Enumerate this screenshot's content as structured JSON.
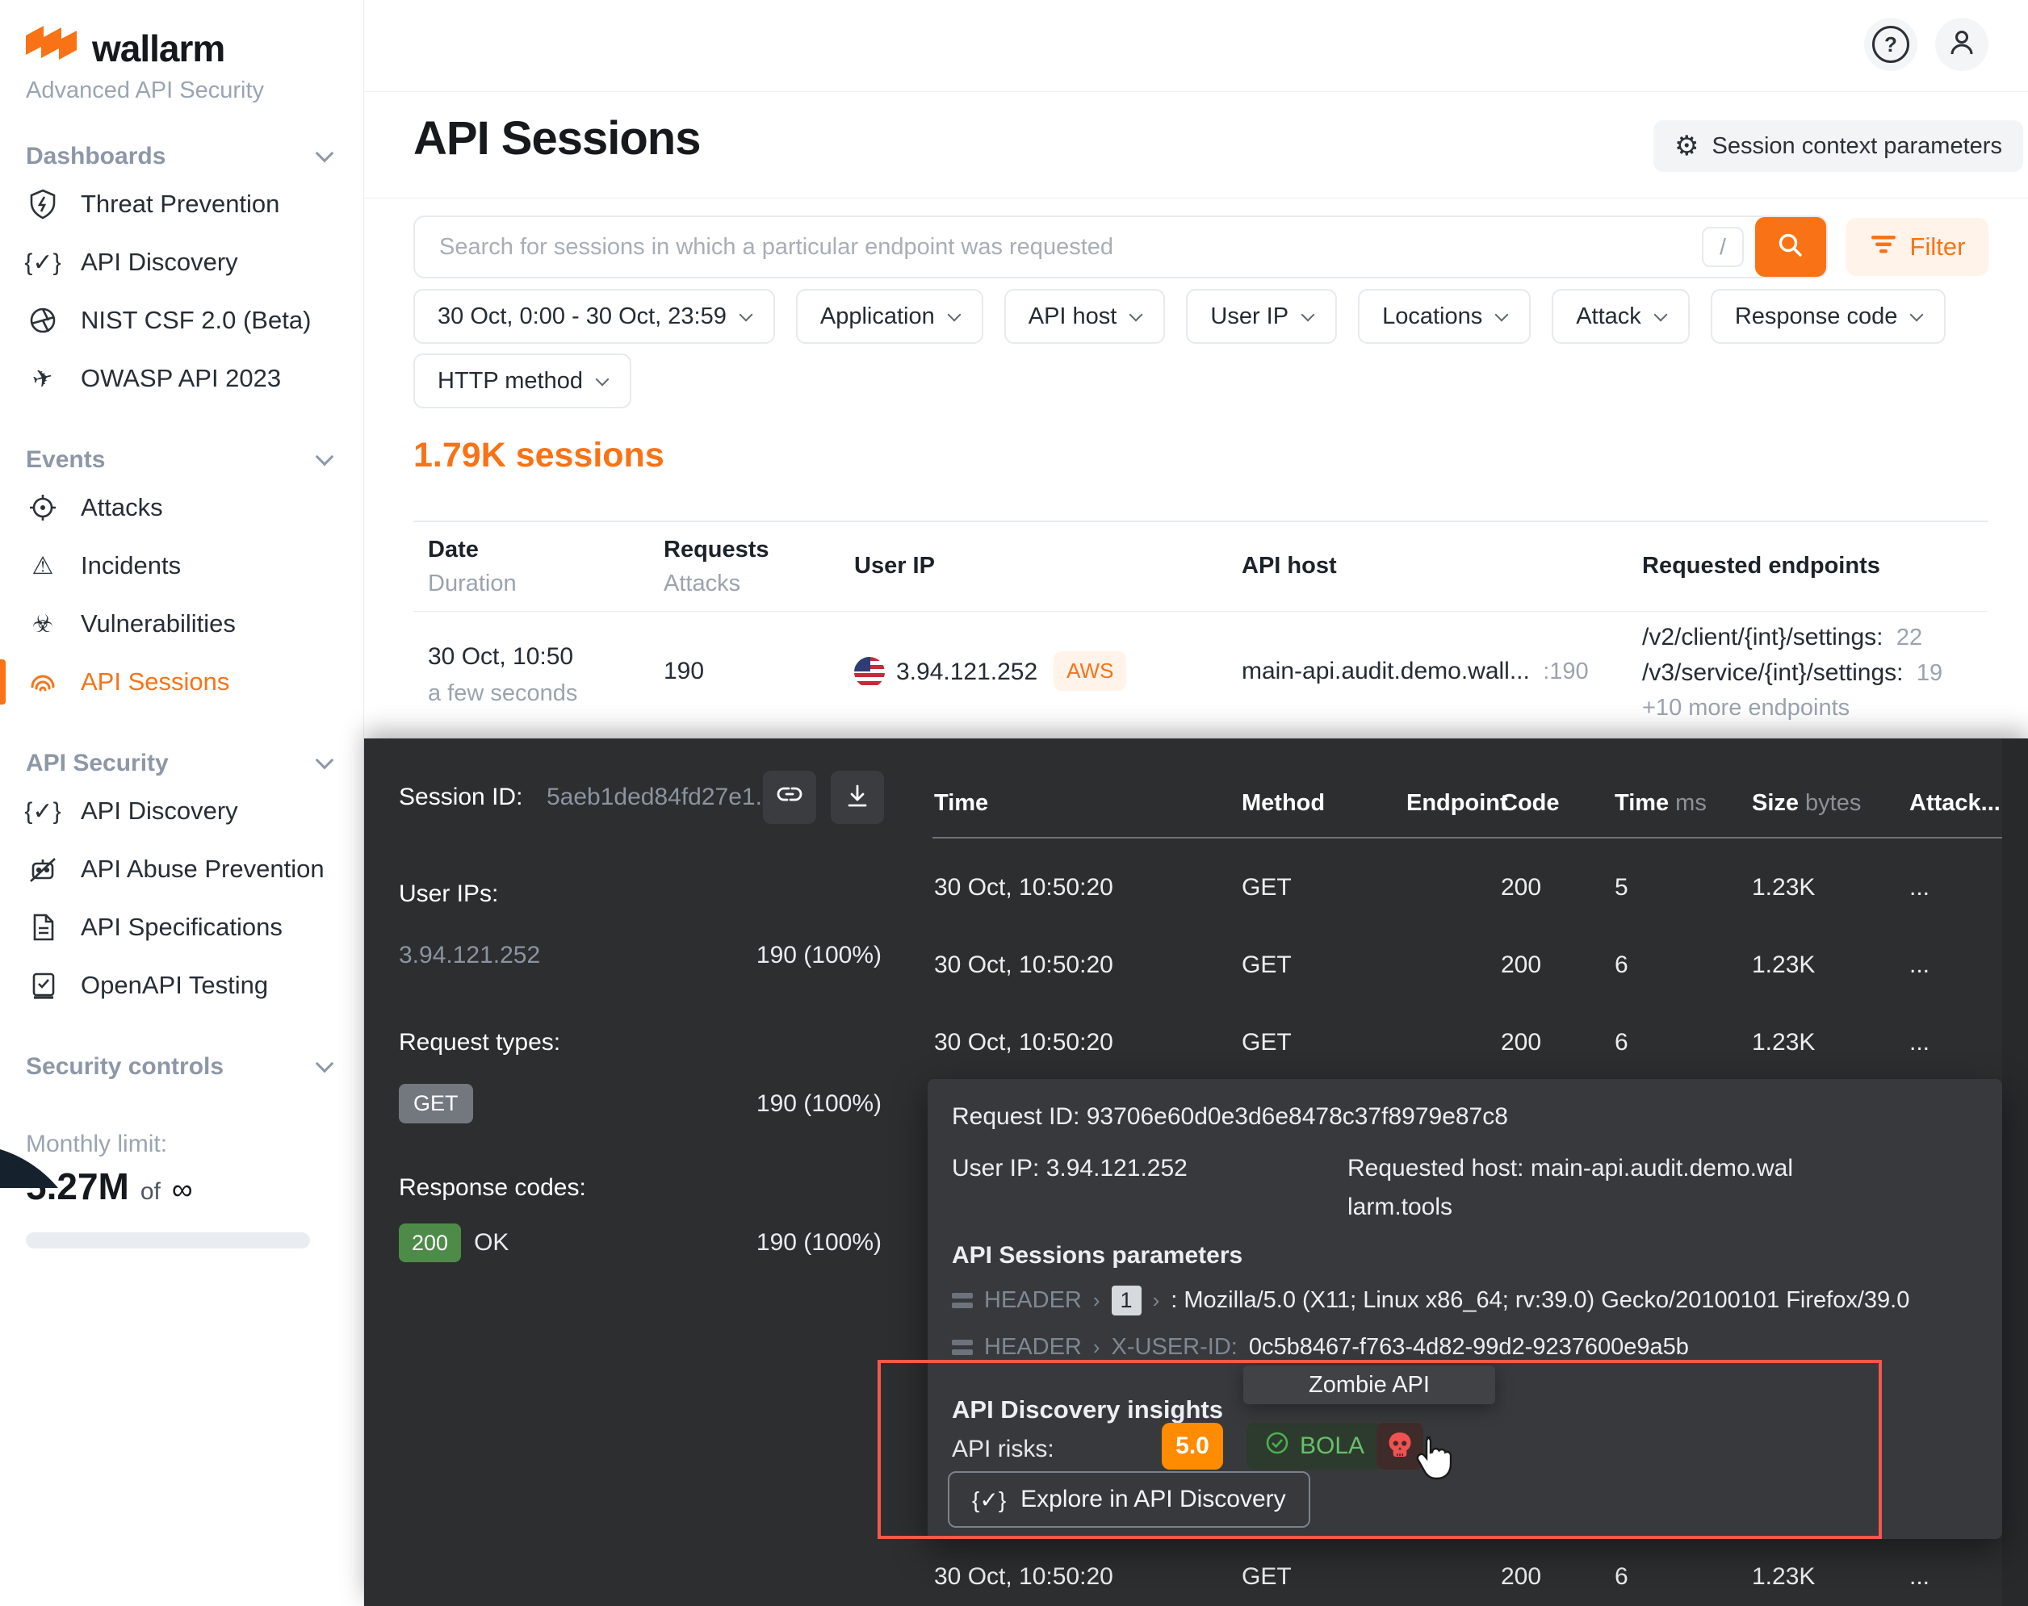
{
  "brand": {
    "name": "wallarm",
    "subtitle": "Advanced API Security"
  },
  "sidebar": {
    "sections": [
      {
        "label": "Dashboards",
        "items": [
          {
            "label": "Threat Prevention"
          },
          {
            "label": "API Discovery"
          },
          {
            "label": "NIST CSF 2.0 (Beta)"
          },
          {
            "label": "OWASP API 2023"
          }
        ]
      },
      {
        "label": "Events",
        "items": [
          {
            "label": "Attacks"
          },
          {
            "label": "Incidents"
          },
          {
            "label": "Vulnerabilities"
          },
          {
            "label": "API Sessions"
          }
        ]
      },
      {
        "label": "API Security",
        "items": [
          {
            "label": "API Discovery"
          },
          {
            "label": "API Abuse Prevention"
          },
          {
            "label": "API Specifications"
          },
          {
            "label": "OpenAPI Testing"
          }
        ]
      },
      {
        "label": "Security controls",
        "items": []
      }
    ],
    "monthly_limit": {
      "label": "Monthly limit:",
      "used": "5.27M",
      "of": "of",
      "limit": "∞"
    }
  },
  "header": {
    "title": "API Sessions",
    "context_button_label": "Session context parameters"
  },
  "search": {
    "placeholder": "Search for sessions in which a particular endpoint was requested",
    "shortcut_key": "/",
    "filter_label": "Filter"
  },
  "filter_chips": [
    "30 Oct, 0:00 - 30 Oct, 23:59",
    "Application",
    "API host",
    "User IP",
    "Locations",
    "Attack",
    "Response code",
    "HTTP method"
  ],
  "sessions_summary": "1.79K sessions",
  "sessions_table": {
    "col_date": "Date",
    "col_duration": "Duration",
    "col_requests": "Requests",
    "col_attacks": "Attacks",
    "col_user_ip": "User IP",
    "col_api_host": "API host",
    "col_endpoints": "Requested endpoints",
    "row": {
      "date": "30 Oct, 10:50",
      "duration": "a few seconds",
      "requests": "190",
      "user_ip": "3.94.121.252",
      "user_ip_badge": "AWS",
      "api_host": "main-api.audit.demo.wall...",
      "api_host_sep": ":",
      "api_host_count": "190",
      "endpoint1_path": "/v2/client/{int}/settings:",
      "endpoint1_count": "22",
      "endpoint2_path": "/v3/service/{int}/settings:",
      "endpoint2_count": "19",
      "more_endpoints": "+10 more endpoints"
    }
  },
  "session_panel": {
    "session_id_label": "Session ID:",
    "session_id_value": "5aeb1ded84fd27e1...",
    "user_ips_label": "User IPs:",
    "user_ip": "3.94.121.252",
    "user_ip_stat": "190 (100%)",
    "request_types_label": "Request types:",
    "request_type": "GET",
    "request_type_stat": "190 (100%)",
    "response_codes_label": "Response codes:",
    "response_code": "200",
    "response_code_text": "OK",
    "response_code_stat": "190 (100%)"
  },
  "requests_table": {
    "col_time": "Time",
    "col_method": "Method",
    "col_endpoint": "Endpoint",
    "col_code": "Code",
    "col_time2": "Time",
    "col_time2_unit": "ms",
    "col_size": "Size",
    "col_size_unit": "bytes",
    "col_attack": "Attack...",
    "rows": [
      {
        "time": "30 Oct, 10:50:20",
        "method": "GET",
        "code": "200",
        "time_ms": "5",
        "size": "1.23K",
        "attack": "..."
      },
      {
        "time": "30 Oct, 10:50:20",
        "method": "GET",
        "code": "200",
        "time_ms": "6",
        "size": "1.23K",
        "attack": "..."
      },
      {
        "time": "30 Oct, 10:50:20",
        "method": "GET",
        "code": "200",
        "time_ms": "6",
        "size": "1.23K",
        "attack": "..."
      },
      {
        "time": "30 Oct, 10:50:20",
        "method": "GET",
        "code": "200",
        "time_ms": "6",
        "size": "1.23K",
        "attack": "..."
      }
    ]
  },
  "request_details": {
    "request_id": "Request ID: 93706e60d0e3d6e8478c37f8979e87c8",
    "user_ip": "User IP: 3.94.121.252",
    "requested_host_line1": "Requested host: main-api.audit.demo.wal",
    "requested_host_line2": "larm.tools",
    "params_title": "API Sessions parameters",
    "param1": {
      "source": "HEADER",
      "sep": "›",
      "key": "1",
      "sep2": "›",
      "value": ": Mozilla/5.0 (X11; Linux x86_64; rv:39.0) Gecko/20100101 Firefox/39.0"
    },
    "param2": {
      "source": "HEADER",
      "sep": "›",
      "key": "X-USER-ID:",
      "value": "0c5b8467-f763-4d82-99d2-9237600e9a5b"
    }
  },
  "insights": {
    "title": "API Discovery insights",
    "risks_label": "API risks:",
    "risk_score": "5.0",
    "bola_label": "BOLA",
    "tooltip": "Zombie API",
    "explore_button": "Explore in API Discovery"
  },
  "colors": {
    "accent": "#f97316",
    "risk_orange": "#ff8b00",
    "bola_green": "#68c06a",
    "code_green": "#4e8b49",
    "annotation_red": "#f2594c",
    "overlay_bg": "#2d2e30",
    "popup_bg": "#38393c"
  }
}
